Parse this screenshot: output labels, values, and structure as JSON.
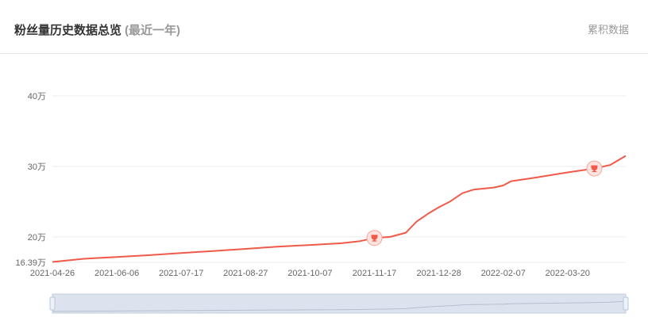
{
  "header": {
    "title": "粉丝量历史数据总览",
    "subtitle": "(最近一年)",
    "action_label": "累积数据"
  },
  "colors": {
    "line": "#ef5a49",
    "grid": "#ececec",
    "axis_text": "#666666",
    "slider_fill": "#dde3ee",
    "slider_border": "#c4ccda",
    "slider_handle": "#b8c6dc"
  },
  "icons": {
    "marker": "trophy-icon"
  },
  "chart_data": {
    "type": "line",
    "title": "粉丝量历史数据总览",
    "y_unit": "万",
    "ylim": [
      16.39,
      40
    ],
    "y_ticks": [
      16.39,
      20,
      30,
      40
    ],
    "y_tick_labels": [
      "16.39万",
      "20万",
      "30万",
      "40万"
    ],
    "x_tick_labels": [
      "2021-04-26",
      "2021-06-06",
      "2021-07-17",
      "2021-08-27",
      "2021-10-07",
      "2021-11-17",
      "2021-12-28",
      "2022-02-07",
      "2022-03-20"
    ],
    "x_range": [
      "2021-04-26",
      "2022-04-26"
    ],
    "grid": true,
    "series": [
      {
        "points": [
          [
            "2021-04-26",
            16.45
          ],
          [
            "2021-05-16",
            16.9
          ],
          [
            "2021-06-06",
            17.15
          ],
          [
            "2021-06-26",
            17.4
          ],
          [
            "2021-07-17",
            17.7
          ],
          [
            "2021-08-06",
            18.0
          ],
          [
            "2021-08-27",
            18.3
          ],
          [
            "2021-09-16",
            18.6
          ],
          [
            "2021-10-07",
            18.85
          ],
          [
            "2021-10-27",
            19.1
          ],
          [
            "2021-11-08",
            19.4
          ],
          [
            "2021-11-17",
            19.85
          ],
          [
            "2021-11-27",
            20.0
          ],
          [
            "2021-12-07",
            20.6
          ],
          [
            "2021-12-14",
            22.2
          ],
          [
            "2021-12-22",
            23.4
          ],
          [
            "2021-12-28",
            24.2
          ],
          [
            "2022-01-04",
            25.0
          ],
          [
            "2022-01-12",
            26.2
          ],
          [
            "2022-01-19",
            26.7
          ],
          [
            "2022-02-01",
            27.0
          ],
          [
            "2022-02-07",
            27.3
          ],
          [
            "2022-02-12",
            27.9
          ],
          [
            "2022-02-27",
            28.4
          ],
          [
            "2022-03-20",
            29.15
          ],
          [
            "2022-04-06",
            29.7
          ],
          [
            "2022-04-16",
            30.2
          ],
          [
            "2022-04-26",
            31.5
          ]
        ]
      }
    ],
    "markers": [
      {
        "date": "2021-11-17",
        "value": 19.85,
        "icon": "trophy-icon"
      },
      {
        "date": "2022-04-06",
        "value": 29.7,
        "icon": "trophy-icon"
      }
    ],
    "data_zoom": {
      "start": 0,
      "end": 1
    }
  }
}
